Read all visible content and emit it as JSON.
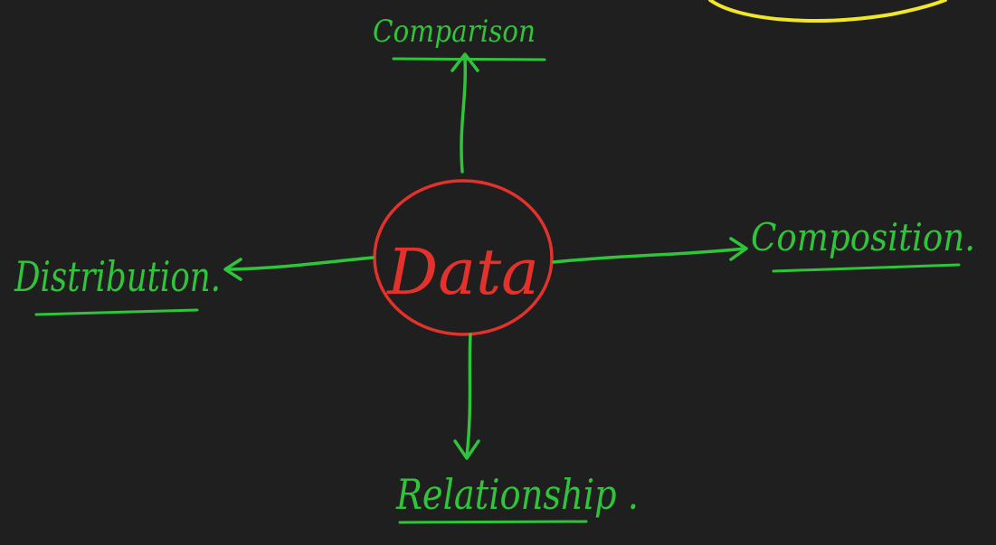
{
  "diagram": {
    "center": {
      "label": "Data"
    },
    "branches": {
      "top": {
        "label": "Comparison"
      },
      "right": {
        "label": "Composition."
      },
      "bottom": {
        "label": "Relationship ."
      },
      "left": {
        "label": "Distribution."
      }
    }
  },
  "colors": {
    "background": "#1f1f1f",
    "ink_green": "#2fc43a",
    "ink_red": "#e2322b",
    "ink_yellow": "#f2e62a"
  }
}
